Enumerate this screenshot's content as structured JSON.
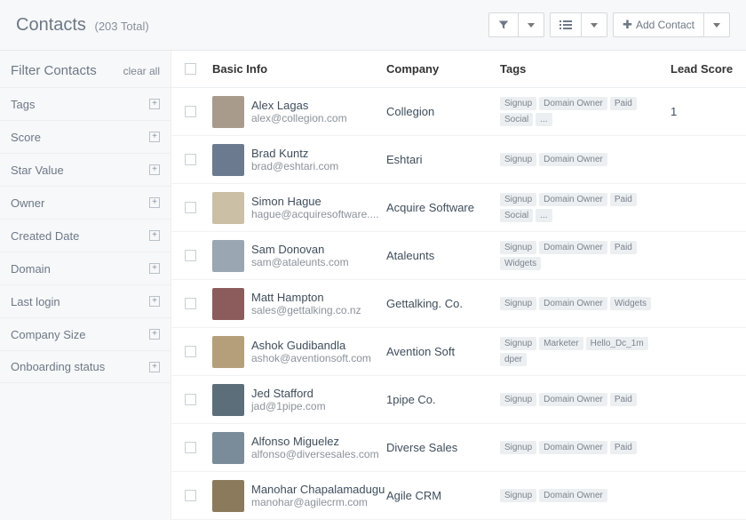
{
  "header": {
    "title": "Contacts",
    "count_label": "(203 Total)",
    "add_label": "Add Contact"
  },
  "sidebar": {
    "title": "Filter Contacts",
    "clear_label": "clear all",
    "filters": [
      {
        "label": "Tags"
      },
      {
        "label": "Score"
      },
      {
        "label": "Star Value"
      },
      {
        "label": "Owner"
      },
      {
        "label": "Created Date"
      },
      {
        "label": "Domain"
      },
      {
        "label": "Last login"
      },
      {
        "label": "Company Size"
      },
      {
        "label": "Onboarding status"
      }
    ]
  },
  "table": {
    "columns": {
      "basic": "Basic Info",
      "company": "Company",
      "tags": "Tags",
      "score": "Lead Score"
    },
    "rows": [
      {
        "name": "Alex Lagas",
        "email": "alex@collegion.com",
        "company": "Collegion",
        "tags": [
          "Signup",
          "Domain Owner",
          "Paid",
          "Social",
          "..."
        ],
        "score": "1"
      },
      {
        "name": "Brad Kuntz",
        "email": "brad@eshtari.com",
        "company": "Eshtari",
        "tags": [
          "Signup",
          "Domain Owner"
        ],
        "score": ""
      },
      {
        "name": "Simon Hague",
        "email": "hague@acquiresoftware....",
        "company": "Acquire Software",
        "tags": [
          "Signup",
          "Domain Owner",
          "Paid",
          "Social",
          "..."
        ],
        "score": ""
      },
      {
        "name": "Sam Donovan",
        "email": "sam@ataleunts.com",
        "company": "Ataleunts",
        "tags": [
          "Signup",
          "Domain Owner",
          "Paid",
          "Widgets"
        ],
        "score": ""
      },
      {
        "name": "Matt Hampton",
        "email": "sales@gettalking.co.nz",
        "company": "Gettalking. Co.",
        "tags": [
          "Signup",
          "Domain Owner",
          "Widgets"
        ],
        "score": ""
      },
      {
        "name": "Ashok Gudibandla",
        "email": "ashok@aventionsoft.com",
        "company": "Avention Soft",
        "tags": [
          "Signup",
          "Marketer",
          "Hello_Dc_1m",
          "dper"
        ],
        "score": ""
      },
      {
        "name": "Jed Stafford",
        "email": "jad@1pipe.com",
        "company": "1pipe Co.",
        "tags": [
          "Signup",
          "Domain Owner",
          "Paid"
        ],
        "score": ""
      },
      {
        "name": "Alfonso Miguelez",
        "email": "alfonso@diversesales.com",
        "company": "Diverse Sales",
        "tags": [
          "Signup",
          "Domain Owner",
          "Paid"
        ],
        "score": ""
      },
      {
        "name": "Manohar Chapalamadugu",
        "email": "manohar@agilecrm.com",
        "company": "Agile CRM",
        "tags": [
          "Signup",
          "Domain Owner"
        ],
        "score": ""
      }
    ]
  }
}
